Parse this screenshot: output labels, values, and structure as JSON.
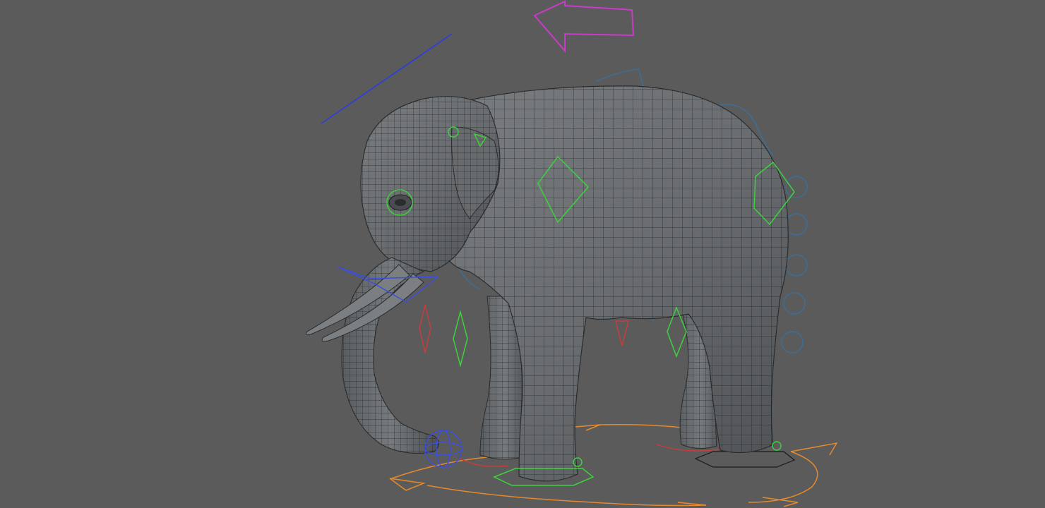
{
  "scene": {
    "background_color": "#5b5b5b",
    "model": {
      "subject": "elephant",
      "display": "wireframe-on-shaded",
      "mesh_fill": "#6d7073",
      "mesh_wire": "#1c1e20"
    },
    "rig_controls": {
      "ik_fk_switch_color": "#c83cc8",
      "root_control_color": "#e48a2c",
      "fk_control_color": "#3cd23c",
      "spine_control_color": "#3a6f9c",
      "pole_vector_color": "#c83c3c",
      "aim_line_color": "#2a3ee0",
      "trunk_tip_color": "#3a4ee0"
    }
  }
}
